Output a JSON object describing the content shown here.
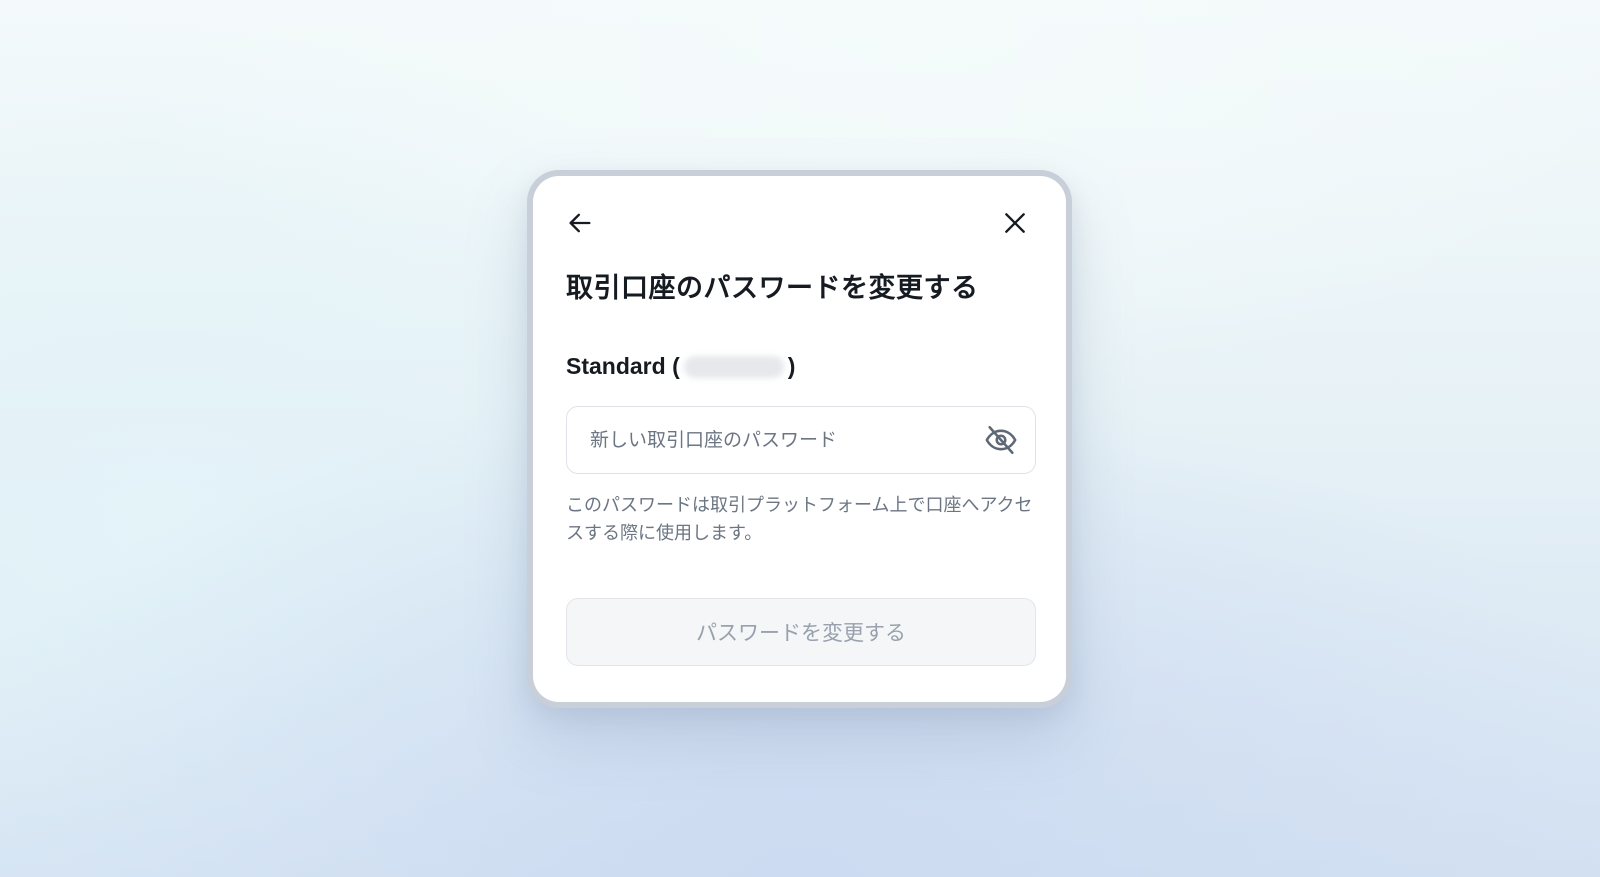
{
  "modal": {
    "title": "取引口座のパスワードを変更する",
    "account_label_prefix": "Standard (",
    "account_label_suffix": ")",
    "password_input": {
      "placeholder": "新しい取引口座のパスワード",
      "value": ""
    },
    "helper_text": "このパスワードは取引プラットフォーム上で口座へアクセスする際に使用します。",
    "submit_label": "パスワードを変更する",
    "icons": {
      "back": "arrow-left-icon",
      "close": "close-icon",
      "visibility": "eye-off-icon"
    },
    "colors": {
      "title": "#161b22",
      "muted_text": "#6b7583",
      "disabled_button_text": "#98a1ad",
      "disabled_button_bg": "#f4f6f8"
    }
  }
}
